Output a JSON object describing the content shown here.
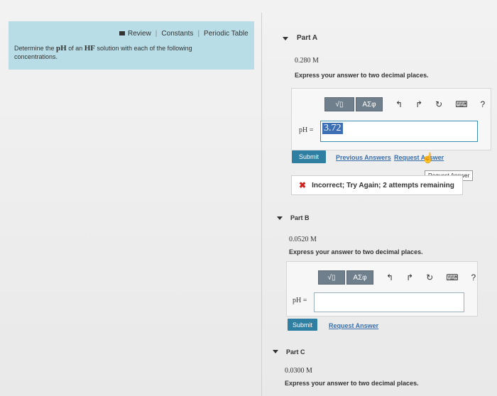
{
  "top_links": {
    "review": "Review",
    "constants": "Constants",
    "periodic_table": "Periodic Table",
    "separator": "|"
  },
  "problem": {
    "prefix": "Determine the ",
    "ph": "pH",
    "middle": " of an ",
    "hf": "HF",
    "suffix": " solution with each of the following concentrations."
  },
  "part_a": {
    "title": "Part A",
    "concentration": "0.280 M",
    "instruction": "Express your answer to two decimal places.",
    "ph_label": "pH =",
    "answer_value": "3.72",
    "submit": "Submit",
    "previous_answers": "Previous Answers",
    "request_answer": "Request Answer",
    "tooltip": "Request Answer",
    "feedback_icon": "✖",
    "feedback": "Incorrect; Try Again; 2 attempts remaining"
  },
  "part_b": {
    "title": "Part B",
    "concentration": "0.0520 M",
    "instruction": "Express your answer to two decimal places.",
    "ph_label": "pH =",
    "submit": "Submit",
    "request_answer": "Request Answer"
  },
  "part_c": {
    "title": "Part C",
    "concentration": "0.0300 M",
    "instruction": "Express your answer to two decimal places."
  },
  "toolbar": {
    "templates": "√▯",
    "greek": "ΑΣφ",
    "undo": "↰",
    "redo": "↱",
    "reset": "↻",
    "keyboard": "⌨",
    "help": "?"
  },
  "icons": {
    "book": "book-icon",
    "caret": "caret-down-icon",
    "x": "x-icon",
    "cursor": "hand-pointer-icon"
  }
}
